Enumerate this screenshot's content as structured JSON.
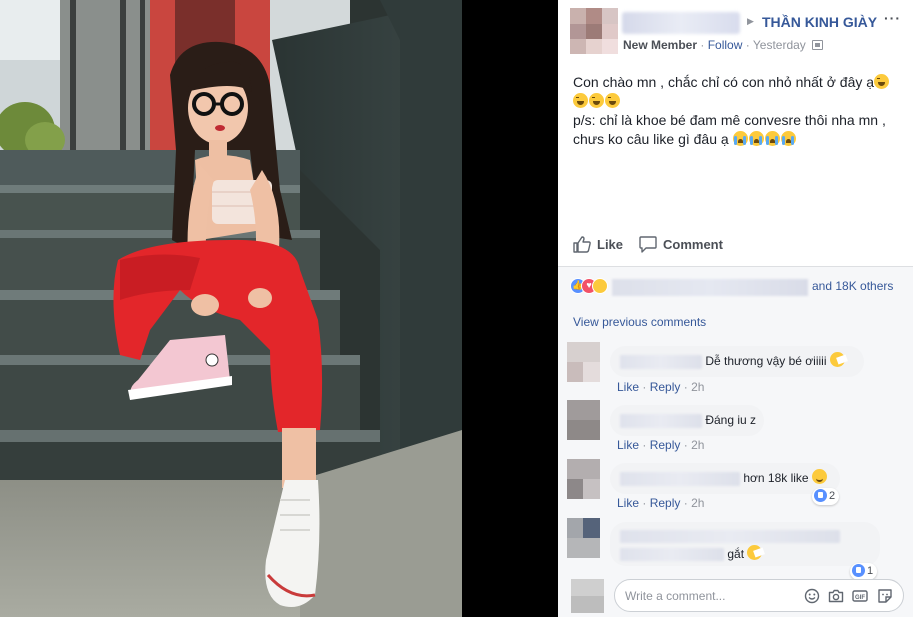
{
  "post": {
    "group_name": "THẦN KINH GIÀY",
    "member_role": "New Member",
    "follow_label": "Follow",
    "time": "Yesterday",
    "more_label": "···",
    "text": {
      "line1": "Con chào mn , chắc chỉ có con nhỏ nhất ở đây ạ",
      "line2": "",
      "line3": "p/s: chỉ là khoe bé đam mê convesre thôi nha mn ,",
      "line4": "chưs ko câu like gì đâu ạ"
    }
  },
  "actions": {
    "like_label": "Like",
    "comment_label": "Comment"
  },
  "reactions": {
    "others_text": "and 18K others"
  },
  "comments": {
    "view_previous": "View previous comments",
    "items": [
      {
        "text": "Dễ thương vậy bé ơiiiii",
        "like_label": "Like",
        "reply_label": "Reply",
        "sep": "·",
        "time": "2h"
      },
      {
        "text": "Đáng iu z",
        "like_label": "Like",
        "reply_label": "Reply",
        "sep": "·",
        "time": "2h"
      },
      {
        "text": "hơn 18k like",
        "like_label": "Like",
        "reply_label": "Reply",
        "sep": "·",
        "time": "2h",
        "reaction_count": "2"
      },
      {
        "text": "gắt",
        "reaction_count": "1"
      }
    ]
  },
  "composer": {
    "placeholder": "Write a comment..."
  },
  "icons": {
    "like": "thumbs-up-icon",
    "comment": "speech-bubble-icon",
    "emoji": "emoji-icon",
    "camera": "camera-icon",
    "gif": "gif-icon",
    "sticker": "sticker-icon"
  },
  "colors": {
    "link": "#365899",
    "meta": "#90949c",
    "like_blue": "#5890ff",
    "love_red": "#f25268",
    "haha_yellow": "#fcca3c",
    "jogger_red": "#e3262a"
  }
}
